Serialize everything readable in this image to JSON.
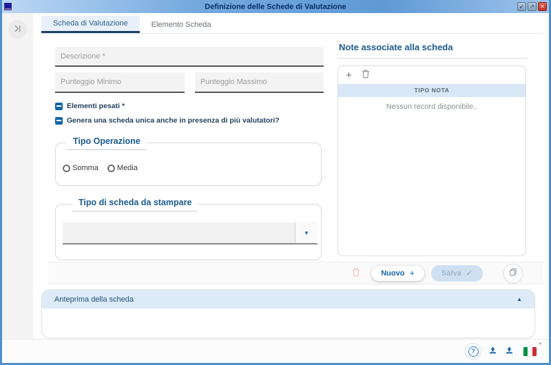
{
  "window": {
    "title": "Definizione delle Schede di Valutazione",
    "controls": [
      {
        "name": "restore-down",
        "glyph": "↙"
      },
      {
        "name": "maximize",
        "glyph": "↗"
      },
      {
        "name": "close",
        "glyph": "✕"
      }
    ]
  },
  "tabs": [
    {
      "label": "Scheda di Valutazione",
      "active": true
    },
    {
      "label": "Elemento Scheda",
      "active": false
    }
  ],
  "form": {
    "descrizione": {
      "placeholder": "Descrizione *",
      "value": ""
    },
    "punteggio_minimo": {
      "placeholder": "Punteggio Minimo",
      "value": ""
    },
    "punteggio_massimo": {
      "placeholder": "Punteggio Massimo",
      "value": ""
    },
    "elementi_pesati": {
      "label": "Elementi pesati *",
      "checked": true
    },
    "scheda_unica": {
      "label": "Genera una scheda unica anche in presenza di più valutatori?",
      "checked": true
    },
    "tipo_operazione": {
      "legend": "Tipo Operazione",
      "options": [
        {
          "label": "Somma",
          "selected": false
        },
        {
          "label": "Media",
          "selected": false
        }
      ]
    },
    "tipo_scheda_stampa": {
      "legend": "Tipo di scheda da stampare",
      "selected": "",
      "dropdown_glyph": "▼"
    }
  },
  "note_panel": {
    "title": "Note associate alla scheda",
    "add_glyph": "+",
    "column_header": "TIPO NOTA",
    "empty_message": "Nessun record disponibile.."
  },
  "actions": {
    "nuovo_label": "Nuovo",
    "nuovo_glyph": "+",
    "salva_label": "Salva",
    "salva_glyph": "✓"
  },
  "anteprima": {
    "title": "Anteprima della scheda",
    "collapse_glyph": "▲"
  },
  "statusbar": {
    "help_glyph": "?",
    "caret_glyph": "▾"
  },
  "colors": {
    "accent_blue": "#1565a9",
    "heading_blue": "#1a5a8e",
    "titlebar_text": "#0a2d5e",
    "tab_active_underline": "#1d4068",
    "table_header_bg": "#d9e8f6",
    "panel_header_bg": "#ddeaf8",
    "flag_green": "#009246",
    "flag_red": "#ce2b37"
  }
}
